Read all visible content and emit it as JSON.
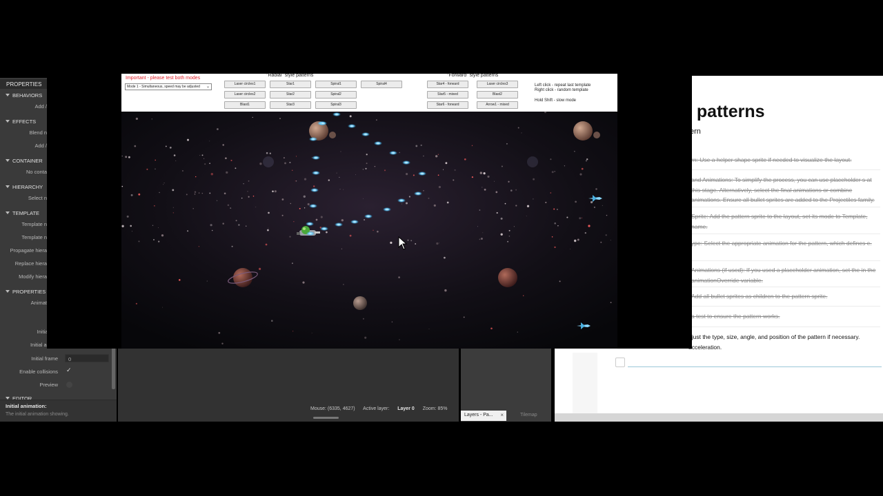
{
  "properties_panel": {
    "header": "PROPERTIES",
    "sections": [
      {
        "label": "BEHAVIORS",
        "rows": [
          "Add /"
        ]
      },
      {
        "label": "EFFECTS",
        "rows": [
          "Blend n",
          "Add /"
        ]
      },
      {
        "label": "CONTAINER",
        "rows": [
          "No conta"
        ]
      },
      {
        "label": "HIERARCHY",
        "rows": [
          "Select n"
        ]
      },
      {
        "label": "TEMPLATE",
        "rows": [
          "Template n",
          "Template n",
          "Propagate hiera",
          "Replace hiera",
          "Modify hiera"
        ]
      },
      {
        "label": "PROPERTIES",
        "rows": [
          "Animat"
        ]
      }
    ],
    "initially_visible": "Initially vi",
    "initial_animation": "Initial anima",
    "initial_frame_label": "Initial frame",
    "initial_frame_value": "0",
    "enable_collisions_label": "Enable collisions",
    "preview_label": "Preview",
    "editor_section": "EDITOR",
    "footer_title": "Initial animation:",
    "footer_desc": "The initial animation showing."
  },
  "status": {
    "mouse": "Mouse: (6335, 4627)",
    "active_layer_label": "Active layer:",
    "active_layer_value": "Layer 0",
    "zoom": "Zoom: 85%"
  },
  "layers": {
    "tab": "Layers - Pa...",
    "close": "×",
    "tilemap": "Tilemap"
  },
  "doc": {
    "title": "l patterns",
    "subtitle": "ern",
    "steps": [
      "rn: Use a helper shape sprite if needed to visualize the layout.",
      "and Animations: To simplify the process, you can use placeholder s at this stage. Alternatively, select the final animations or combine animations. Ensure all bullet sprites are added to the Projectiles family.",
      "Sprite: Add the pattern sprite to the layout, set its mode to Template, name.",
      "ype: Select the appropriate animation for the pattern, which defines e.",
      "Animations (if used): If you used a placeholder animation, set the in the animationOverride variable.",
      "Add all bullet sprites as children to the pattern sprite.",
      "a test to ensure the pattern works.",
      "djust the type, size, angle, and position of the pattern if necessary. acceleration."
    ]
  },
  "game": {
    "important": "Important - please test both modes",
    "mode_select": "Mode 1 - Simultaneous, speed may be adjusted",
    "radial_title": "\"Radial\" style patterns",
    "forward_title": "\"Forward\" style patterns",
    "radial_buttons": [
      [
        "Laser circles1",
        "Star1",
        "Spiral1",
        "Spiral4"
      ],
      [
        "Laser circles2",
        "Star2",
        "Spiral2"
      ],
      [
        "Blast1",
        "Star3",
        "Spiral3"
      ]
    ],
    "forward_buttons": [
      [
        "Star4 - forward",
        "Laser circles3"
      ],
      [
        "Star5 - mixed",
        "Blast2"
      ],
      [
        "Star6 - forward",
        "Arrow1 - mixed"
      ]
    ],
    "help": [
      "Left click - repeat last template",
      "Right click - random template",
      "Hold Shift - slow mode"
    ]
  },
  "colors": {
    "panel": "#3a3a3a",
    "accent_red": "#e0202a",
    "bullet": "#40d8ff",
    "space": "#0b0b10"
  }
}
